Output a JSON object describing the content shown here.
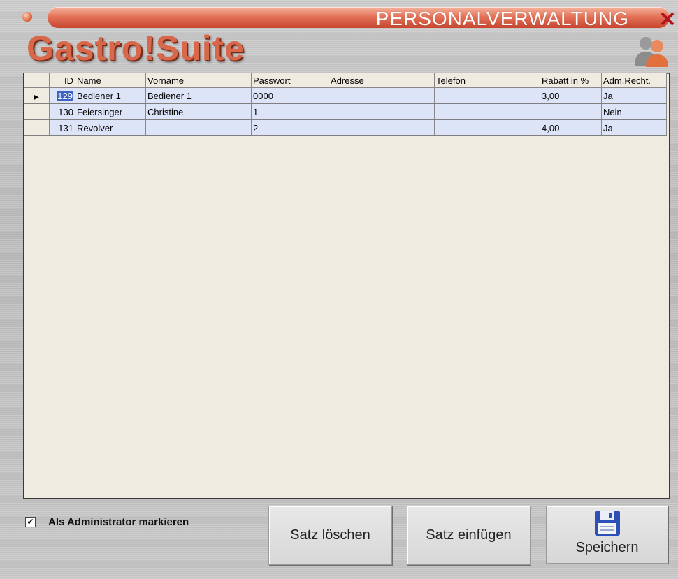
{
  "window": {
    "title": "PERSONALVERWALTUNG",
    "logo_text": "Gastro!Suite",
    "close_glyph": "✕"
  },
  "grid": {
    "columns": [
      "ID",
      "Name",
      "Vorname",
      "Passwort",
      "Adresse",
      "Telefon",
      "Rabatt in %",
      "Adm.Recht."
    ],
    "rows": [
      {
        "id": "129",
        "name": "Bediener 1",
        "vorname": "Bediener 1",
        "passwort": "0000",
        "adresse": "",
        "telefon": "",
        "rabatt": "3,00",
        "adm": "Ja",
        "current": true
      },
      {
        "id": "130",
        "name": "Feiersinger",
        "vorname": "Christine",
        "passwort": "1",
        "adresse": "",
        "telefon": "",
        "rabatt": "",
        "adm": "Nein",
        "current": false
      },
      {
        "id": "131",
        "name": "Revolver",
        "vorname": "",
        "passwort": "2",
        "adresse": "",
        "telefon": "",
        "rabatt": "4,00",
        "adm": "Ja",
        "current": false
      }
    ]
  },
  "admin_checkbox": {
    "label": "Als Administrator markieren",
    "checked": true
  },
  "buttons": {
    "delete": "Satz löschen",
    "insert": "Satz einfügen",
    "save": "Speichern"
  },
  "icons": {
    "users": "users-icon",
    "save": "floppy-disk-icon",
    "close": "close-icon"
  },
  "colors": {
    "row_bg": "#dde4f7",
    "grid_bg": "#f0ebe0",
    "title_bar": "#d9684a",
    "selection": "#3d63c4"
  }
}
